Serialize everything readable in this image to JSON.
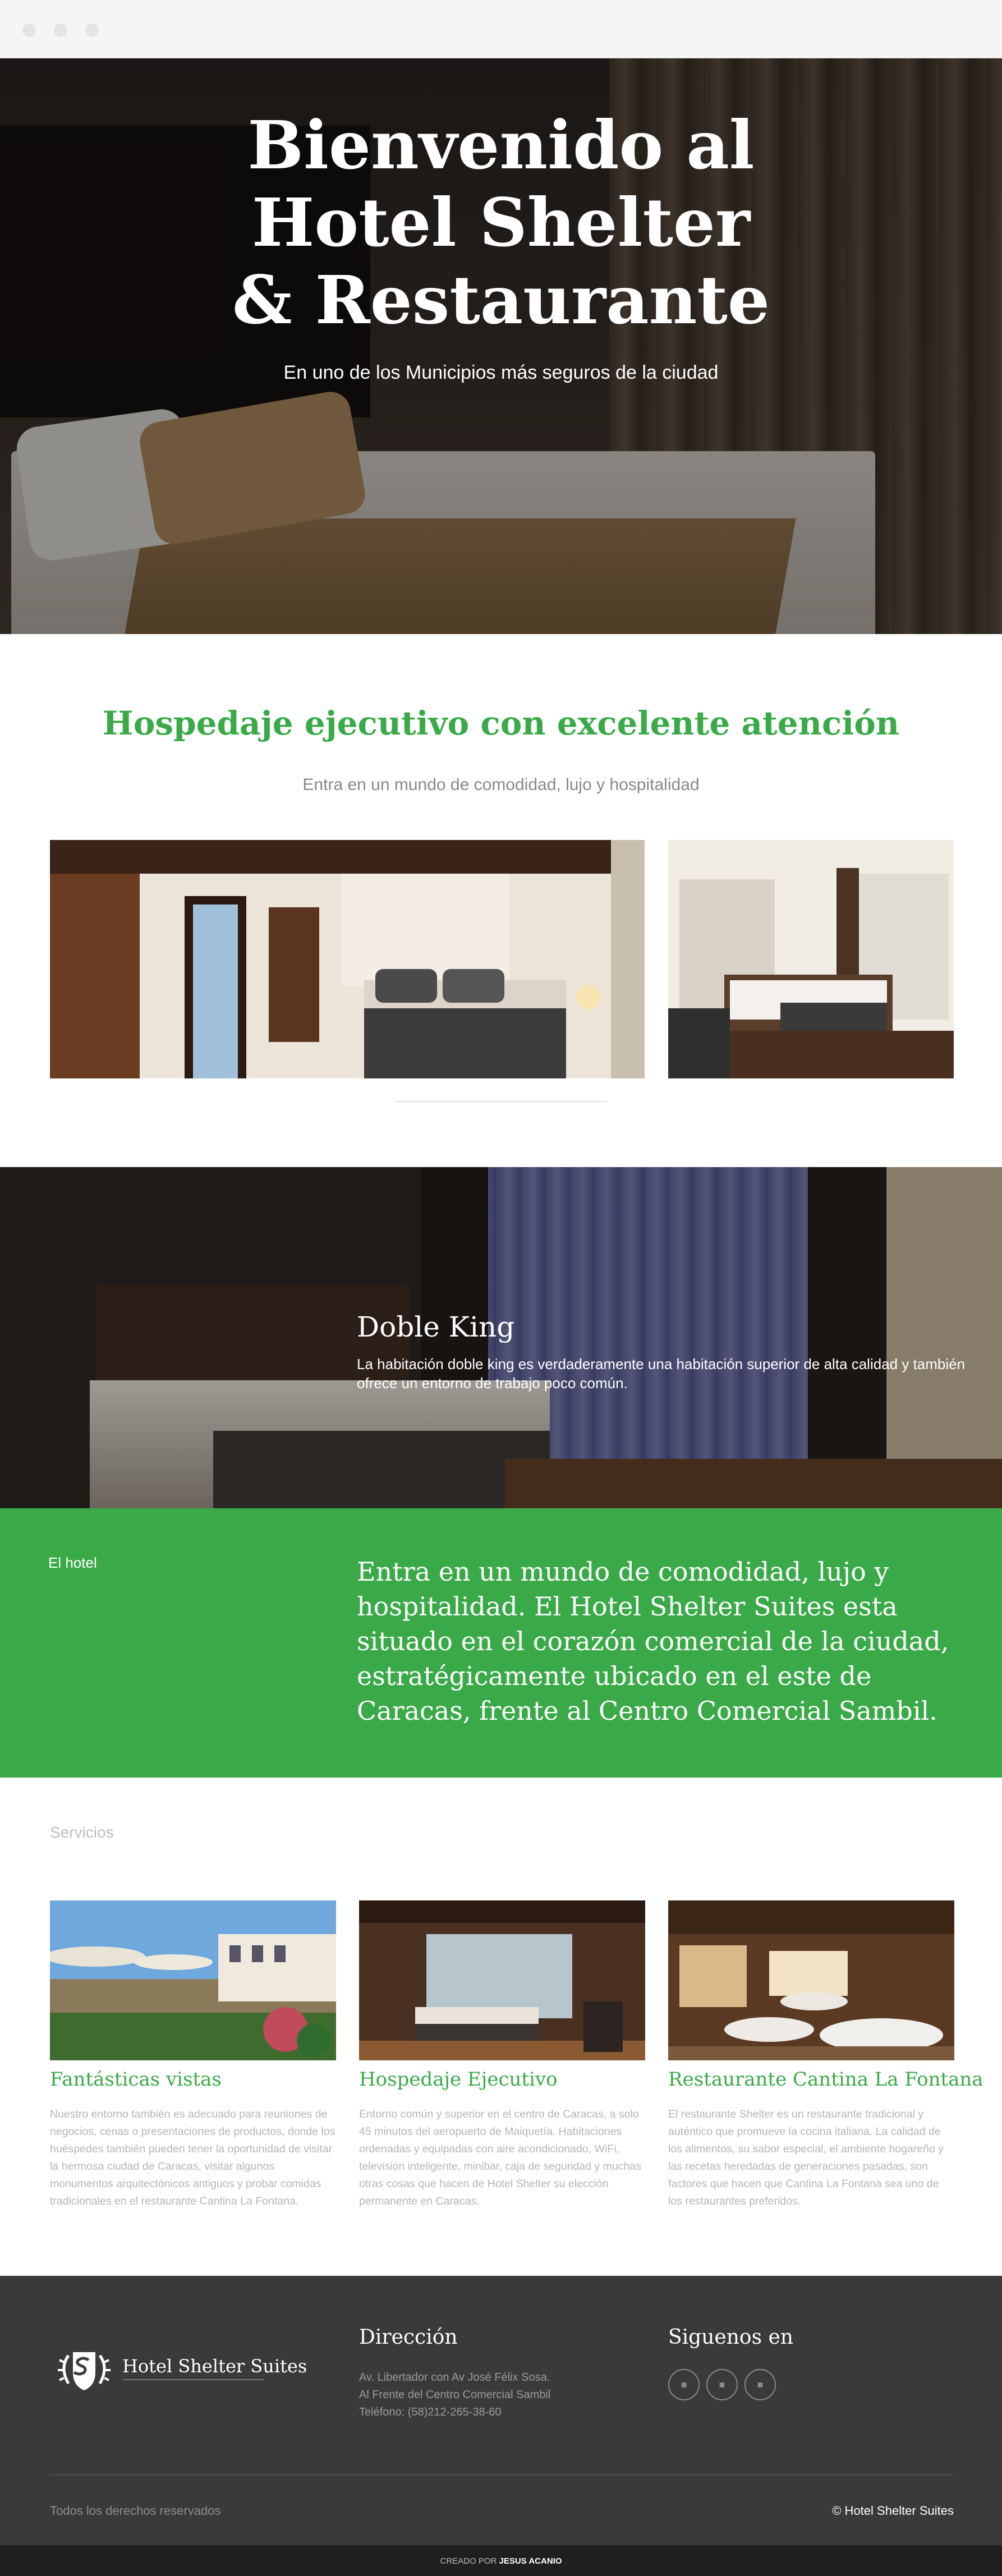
{
  "hero": {
    "title_line1": "Bienvenido al",
    "title_line2": "Hotel Shelter",
    "title_line3": "& Restaurante",
    "subtitle": "En uno de los Municipios más seguros de la ciudad"
  },
  "intro": {
    "title": "Hospedaje ejecutivo con excelente atención",
    "subtitle": "Entra en un mundo de comodidad, lujo y hospitalidad"
  },
  "featured_room": {
    "title": "Doble King",
    "description": "La habitación doble king es verdaderamente una habitación superior de alta calidad y también ofrece un entorno de trabajo poco común."
  },
  "about": {
    "label": "El hotel",
    "text": "Entra en un mundo de comodidad, lujo y hospitalidad. El Hotel Shelter Suites esta situado en el corazón comercial de la ciudad, estratégicamente ubicado en el este de Caracas, frente al Centro Comercial Sambil."
  },
  "services": {
    "label": "Servicios",
    "items": [
      {
        "title": "Fantásticas vistas",
        "text": "Nuestro entorno también es adecuado para reuniones de negocios, cenas o presentaciones de productos, donde los huéspedes también pueden tener la oportunidad de visitar la hermosa ciudad de Caracas, visitar algunos monumentos arquitectónicos antiguos y probar comidas tradicionales en el restaurante Cantina La Fontana."
      },
      {
        "title": "Hospedaje Ejecutivo",
        "text": "Entorno común y superior en el centro de Caracas, a solo 45 minutos del aeropuerto de Maiquetía. Habitaciones ordenadas y equipadas con aire acondicionado, WiFi, televisión inteligente, minibar, caja de seguridad y muchas otras cosas que hacen de Hotel Shelter su elección permanente en Caracas."
      },
      {
        "title": "Restaurante Cantina La Fontana",
        "text": "El restaurante Shelter es un restaurante tradicional y auténtico que promueve la cocina italiana. La calidad de los alimentos, su sabor especial, el ambiente hogareño y las recetas heredadas de generaciones pasadas, son factores que hacen que Cantina La Fontana sea uno de los restaurantes preferidos."
      }
    ]
  },
  "footer": {
    "brand": "Hotel Shelter Suites",
    "address_heading": "Dirección",
    "address_line1": "Av. Libertador con Av José Félix Sosa.",
    "address_line2": "Al Frente del Centro Comercial Sambil",
    "phone": "Teléfono: (58)212-265-38-60",
    "social_heading": "Siguenos en",
    "rights": "Todos los derechos reservados",
    "copyright": "© Hotel Shelter Suites",
    "credit_prefix": "CREADO POR",
    "credit_name": "JESUS ACANIO"
  },
  "colors": {
    "accent_green": "#3aaa48",
    "footer_bg": "#3a3a3a",
    "bottom_bar": "#1f1f1f"
  },
  "icons": {
    "social": [
      "social-icon-1",
      "social-icon-2",
      "social-icon-3"
    ],
    "logo": "shield-laurel-logo"
  }
}
